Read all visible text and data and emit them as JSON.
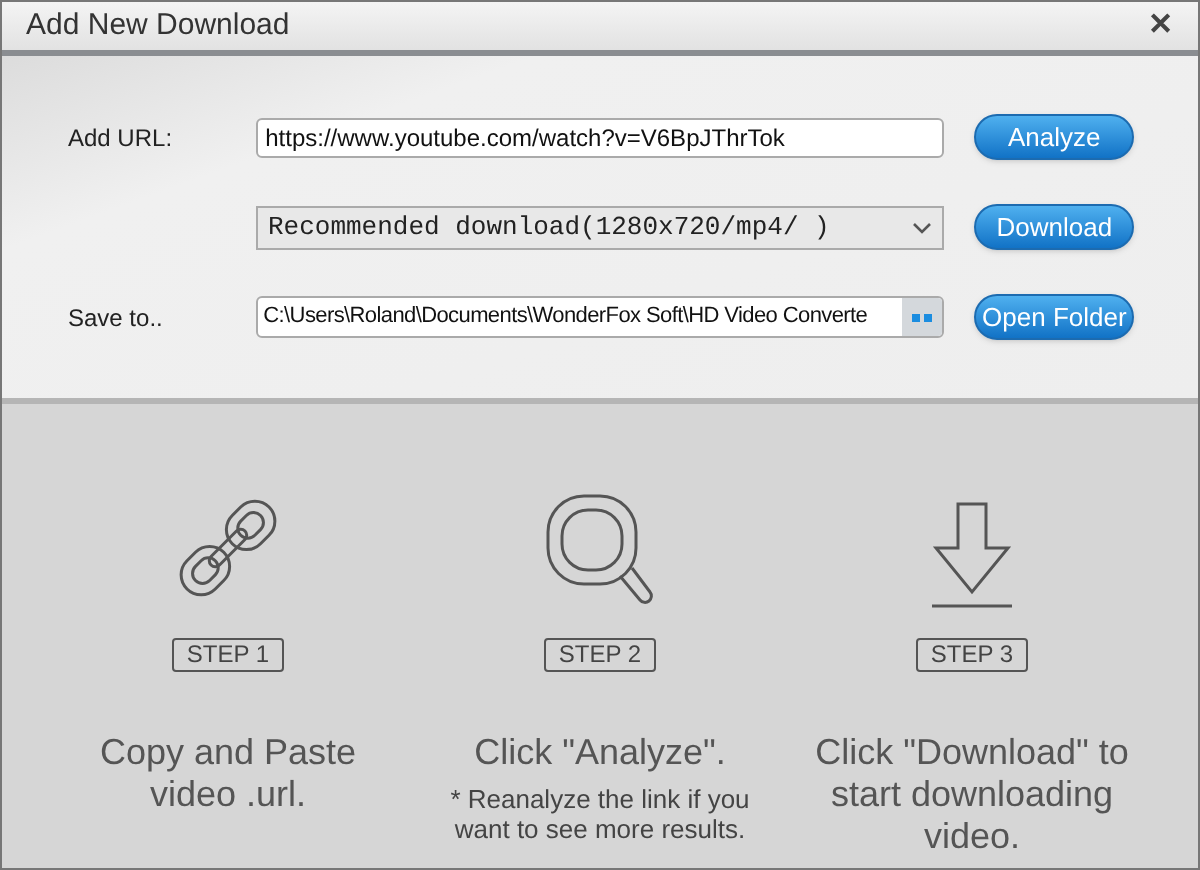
{
  "window": {
    "title": "Add New Download",
    "close": "✕"
  },
  "form": {
    "url_label": "Add URL:",
    "url_value": "https://www.youtube.com/watch?v=V6BpJThrTok",
    "analyze_button": "Analyze",
    "format_value": "Recommended download(1280x720/mp4/ )",
    "download_button": "Download",
    "save_label": "Save to..",
    "save_value": "C:\\Users\\Roland\\Documents\\WonderFox Soft\\HD Video Converte",
    "open_folder_button": "Open Folder"
  },
  "steps": [
    {
      "kind": "link",
      "badge": "STEP 1",
      "text": "Copy and Paste video .url."
    },
    {
      "kind": "search",
      "badge": "STEP 2",
      "text": "Click \"Analyze\".",
      "note": "* Reanalyze the link if you want to see more results."
    },
    {
      "kind": "download",
      "badge": "STEP 3",
      "text": "Click \"Download\" to start downloading video."
    }
  ]
}
